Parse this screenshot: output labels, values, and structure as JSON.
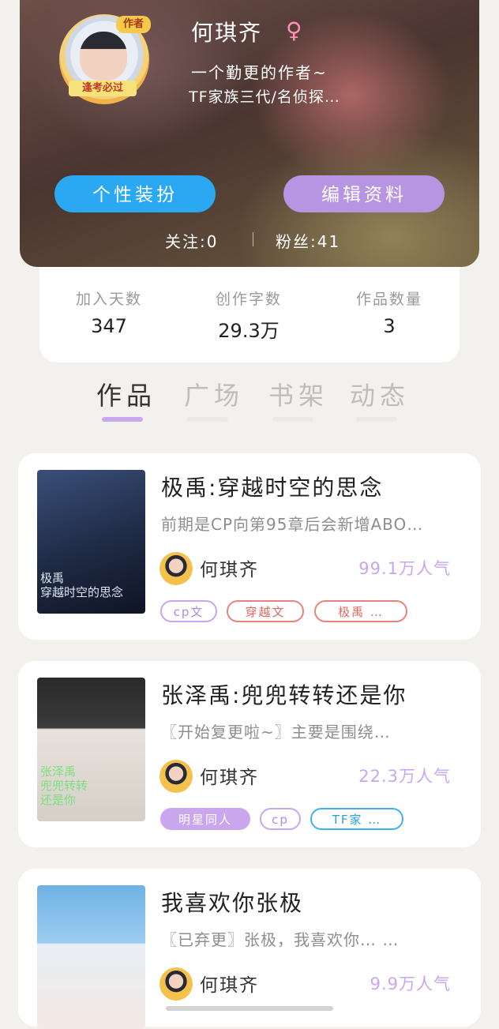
{
  "profile": {
    "avatar_tag": "作者",
    "avatar_banner": "逢考必过",
    "name": "何琪齐",
    "gender_symbol": "♀",
    "bio_line1": "一个勤更的作者~",
    "bio_line2": "TF家族三代/名侦探…",
    "dress_button": "个性装扮",
    "edit_button": "编辑资料",
    "follow_text": "关注:0",
    "fans_text": "粉丝:41"
  },
  "stats": [
    {
      "label": "加入天数",
      "value": "347"
    },
    {
      "label": "创作字数",
      "value": "29.3万"
    },
    {
      "label": "作品数量",
      "value": "3"
    }
  ],
  "tabs": [
    {
      "label": "作品",
      "active": true
    },
    {
      "label": "广场",
      "active": false
    },
    {
      "label": "书架",
      "active": false
    },
    {
      "label": "动态",
      "active": false
    }
  ],
  "works": [
    {
      "title": "极禹:穿越时空的思念",
      "desc": "前期是CP向第95章后会新增ABO…",
      "author": "何琪齐",
      "popularity": "99.1万人气",
      "cover_text": "极禹\n穿越时空的思念",
      "tags": [
        {
          "label": "cp文",
          "style": "purple-outline"
        },
        {
          "label": "穿越文",
          "style": "red-outline"
        },
        {
          "label": "极禹 …",
          "style": "red-outline"
        }
      ]
    },
    {
      "title": "张泽禹:兜兜转转还是你",
      "desc": "〖开始复更啦~〗主要是围绕…",
      "author": "何琪齐",
      "popularity": "22.3万人气",
      "cover_text": "张泽禹\n兜兜转转\n还是你",
      "tags": [
        {
          "label": "明星同人",
          "style": "purple-fill"
        },
        {
          "label": "cp",
          "style": "purple-outline"
        },
        {
          "label": "TF家 …",
          "style": "blue-outline"
        }
      ]
    },
    {
      "title": "我喜欢你张极",
      "desc": "〖已弃更〗张极，我喜欢你… …",
      "author": "何琪齐",
      "popularity": "9.9万人气",
      "cover_text": "",
      "tags": []
    }
  ],
  "colors": {
    "accent_purple": "#c9a6ee",
    "accent_blue": "#2aa8f2",
    "edit_purple": "#b795e2",
    "tag_red": "#e8837c"
  }
}
